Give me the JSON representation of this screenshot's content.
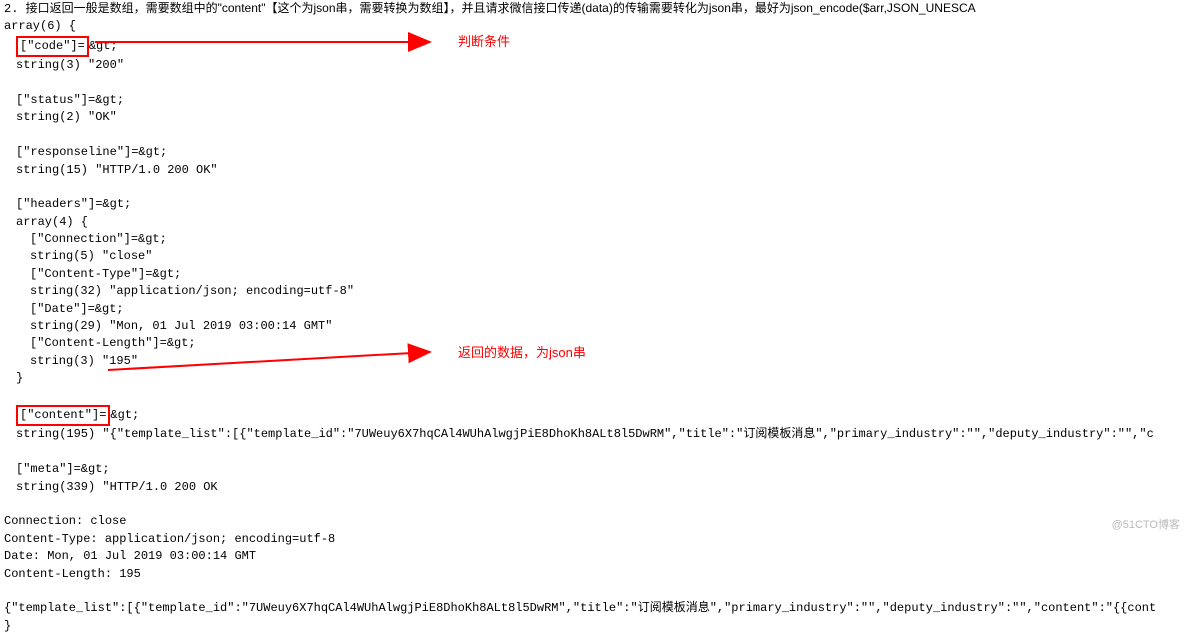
{
  "intro": {
    "prefix": "2. ",
    "text_a": "接口返回一般是数组，需要数组中的\"content\"【这个为json串，需要转换为数组】，并且请求微信接口传递(data)的传输需要转化为json串，最好为json_encode($arr,JSON_UNESCA"
  },
  "dump": {
    "array_open": "array(6) {",
    "code_key": "[\"code\"]=",
    "after_box_gt": "&gt;",
    "code_val": "string(3) \"200\"",
    "status_key": "[\"status\"]=&gt;",
    "status_val": "string(2) \"OK\"",
    "respline_key": "[\"responseline\"]=&gt;",
    "respline_val": "string(15) \"HTTP/1.0 200 OK\"",
    "headers_key": "[\"headers\"]=&gt;",
    "headers_open": "array(4) {",
    "h_conn_key": "[\"Connection\"]=&gt;",
    "h_conn_val": "string(5) \"close\"",
    "h_ct_key": "[\"Content-Type\"]=&gt;",
    "h_ct_val": "string(32) \"application/json; encoding=utf-8\"",
    "h_date_key": "[\"Date\"]=&gt;",
    "h_date_val": "string(29) \"Mon, 01 Jul 2019 03:00:14 GMT\"",
    "h_len_key": "[\"Content-Length\"]=&gt;",
    "h_len_val": "string(3) \"195\"",
    "headers_close": "}",
    "content_key": "[\"content\"]=",
    "content_val": "string(195) \"{\"template_list\":[{\"template_id\":\"7UWeuy6X7hqCAl4WUhAlwgjPiE8DhoKh8ALt8l5DwRM\",\"title\":\"订阅模板消息\",\"primary_industry\":\"\",\"deputy_industry\":\"\",\"c",
    "meta_key": "[\"meta\"]=&gt;",
    "meta_val": "string(339) \"HTTP/1.0 200 OK"
  },
  "tail": {
    "l1": "Connection: close",
    "l2": "Content-Type: application/json; encoding=utf-8",
    "l3": "Date: Mon, 01 Jul 2019 03:00:14 GMT",
    "l4": "Content-Length: 195",
    "json": "{\"template_list\":[{\"template_id\":\"7UWeuy6X7hqCAl4WUhAlwgjPiE8DhoKh8ALt8l5DwRM\",\"title\":\"订阅模板消息\",\"primary_industry\":\"\",\"deputy_industry\":\"\",\"content\":\"{{cont",
    "close": "}"
  },
  "annotations": {
    "a1": "判断条件",
    "a2": "返回的数据，为json串"
  },
  "watermark": "@51CTO博客"
}
